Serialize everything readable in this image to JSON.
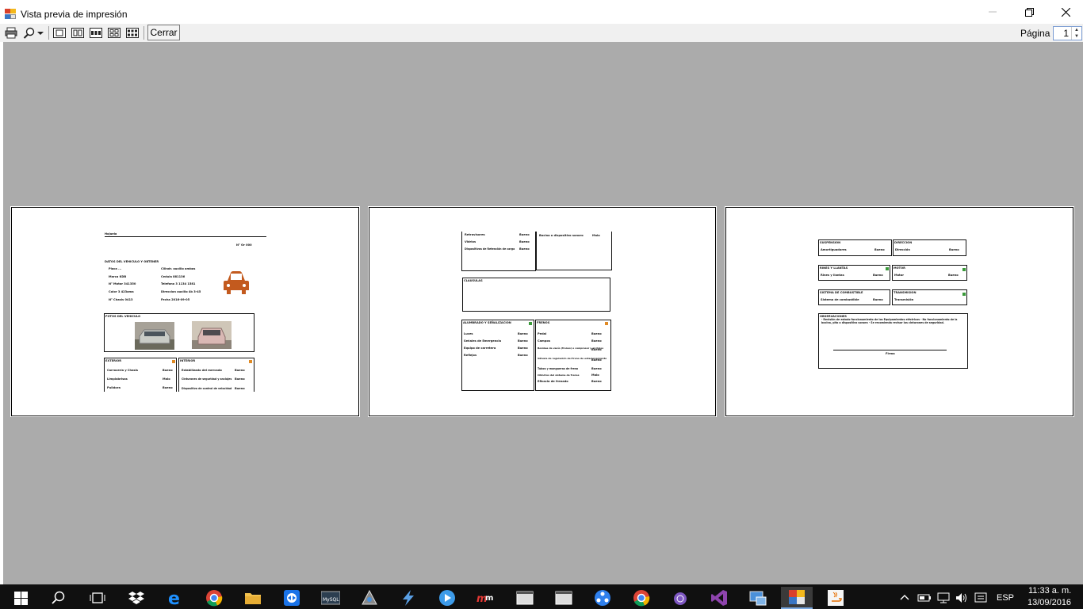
{
  "window": {
    "title": "Vista previa de impresión",
    "page_label": "Página",
    "page_value": "1"
  },
  "toolbar": {
    "close_label": "Cerrar"
  },
  "page1": {
    "header_title": "Hojuela",
    "number": "N° Or 000",
    "section_vehicle": "DATOS DEL VEHICULO Y OBTENER",
    "fields_left": [
      "Placa ...",
      "Marca  KDB",
      "N° Motor 341350",
      "Color  3 423ama",
      "N° Chasis 0413"
    ],
    "fields_right": [
      "Cilindr.  auxilio ambos",
      "Cedula  881136",
      "Telefono  3 1134 1581",
      "Direccion  auxilio 4b 3-45",
      "Fecha  2016-09-05"
    ],
    "section_photos": "FOTOS DEL VEHICULO",
    "exterior_title": "EXTERIOR",
    "exterior_items": [
      [
        "Carrocería y Chasis",
        "Bueno"
      ],
      [
        "Limpiabrisas",
        "Malo"
      ],
      [
        "Pulidora",
        "Bueno"
      ]
    ],
    "interior_title": "INTERIOR",
    "interior_items": [
      [
        "Estabilizado del mercado",
        "Bueno"
      ],
      [
        "Cinturones de seguridad y anclajes",
        "Bueno"
      ],
      [
        "Dispositivo de control de velocidad",
        "Bueno"
      ]
    ]
  },
  "page2": {
    "top_items": [
      [
        "Retrovisores",
        "Bueno"
      ],
      [
        "Vidrios",
        "Bueno"
      ],
      [
        "Dispositivos de Retención de carga",
        "Bueno"
      ]
    ],
    "top_right_item": [
      "Bocina o dispositivo sonoro",
      "Malo"
    ],
    "clauses_title": "CLAUSULAS",
    "lights_title": "ALUMBRADO Y SEÑALIZACION",
    "lights_items": [
      [
        "Luces",
        "Bueno"
      ],
      [
        "Señales de Emergencia",
        "Bueno"
      ],
      [
        "Equipo de carretera",
        "Bueno"
      ],
      [
        "Reflejos",
        "Bueno"
      ]
    ],
    "brakes_title": "FRENOS",
    "brakes_items": [
      [
        "Pedal",
        "Bueno"
      ],
      [
        "Campos",
        "Bueno"
      ],
      [
        "Bombas de vacío (frenos) o compresor y anclajes",
        "Bueno"
      ],
      [
        "Válvula de regulación del freno de estacionamiento",
        "Bueno"
      ],
      [
        "Tubos y mangueras de freno",
        "Bueno"
      ],
      [
        "Cilindros del sistema de frenos",
        "Malo"
      ],
      [
        "Eficacia de frenado",
        "Bueno"
      ]
    ]
  },
  "page3": {
    "suspension_title": "SUSPENSION",
    "suspension_item": [
      "Amortiguadores",
      "Bueno"
    ],
    "steering_title": "DIRECCION",
    "steering_item": [
      "Dirección",
      "Bueno"
    ],
    "wheels_title": "RINES Y LLANTAS",
    "wheels_item": [
      "Rines y llantas",
      "Bueno"
    ],
    "engine_title": "MOTOR",
    "engine_item": [
      "Motor",
      "Bueno"
    ],
    "fuel_title": "SISTEMA DE COMBUSTIBLE",
    "fuel_item": [
      "Sistema de combustible",
      "Bueno"
    ],
    "transmission_title": "TRANSMISION",
    "transmission_item": [
      "Transmisión",
      "Bueno"
    ],
    "observations_title": "OBSERVACIONES",
    "observations_text": "- Revisión de estado funcionamiento de los Equipamientos eléctricos - No funcionamiento de la bocina, pito o dispositivo sonoro - Se recomienda revisar los cinturones de seguridad.",
    "signature_label": "Firma"
  },
  "taskbar": {
    "time": "11:33 a. m.",
    "date": "13/09/2016",
    "language": "ESP"
  }
}
